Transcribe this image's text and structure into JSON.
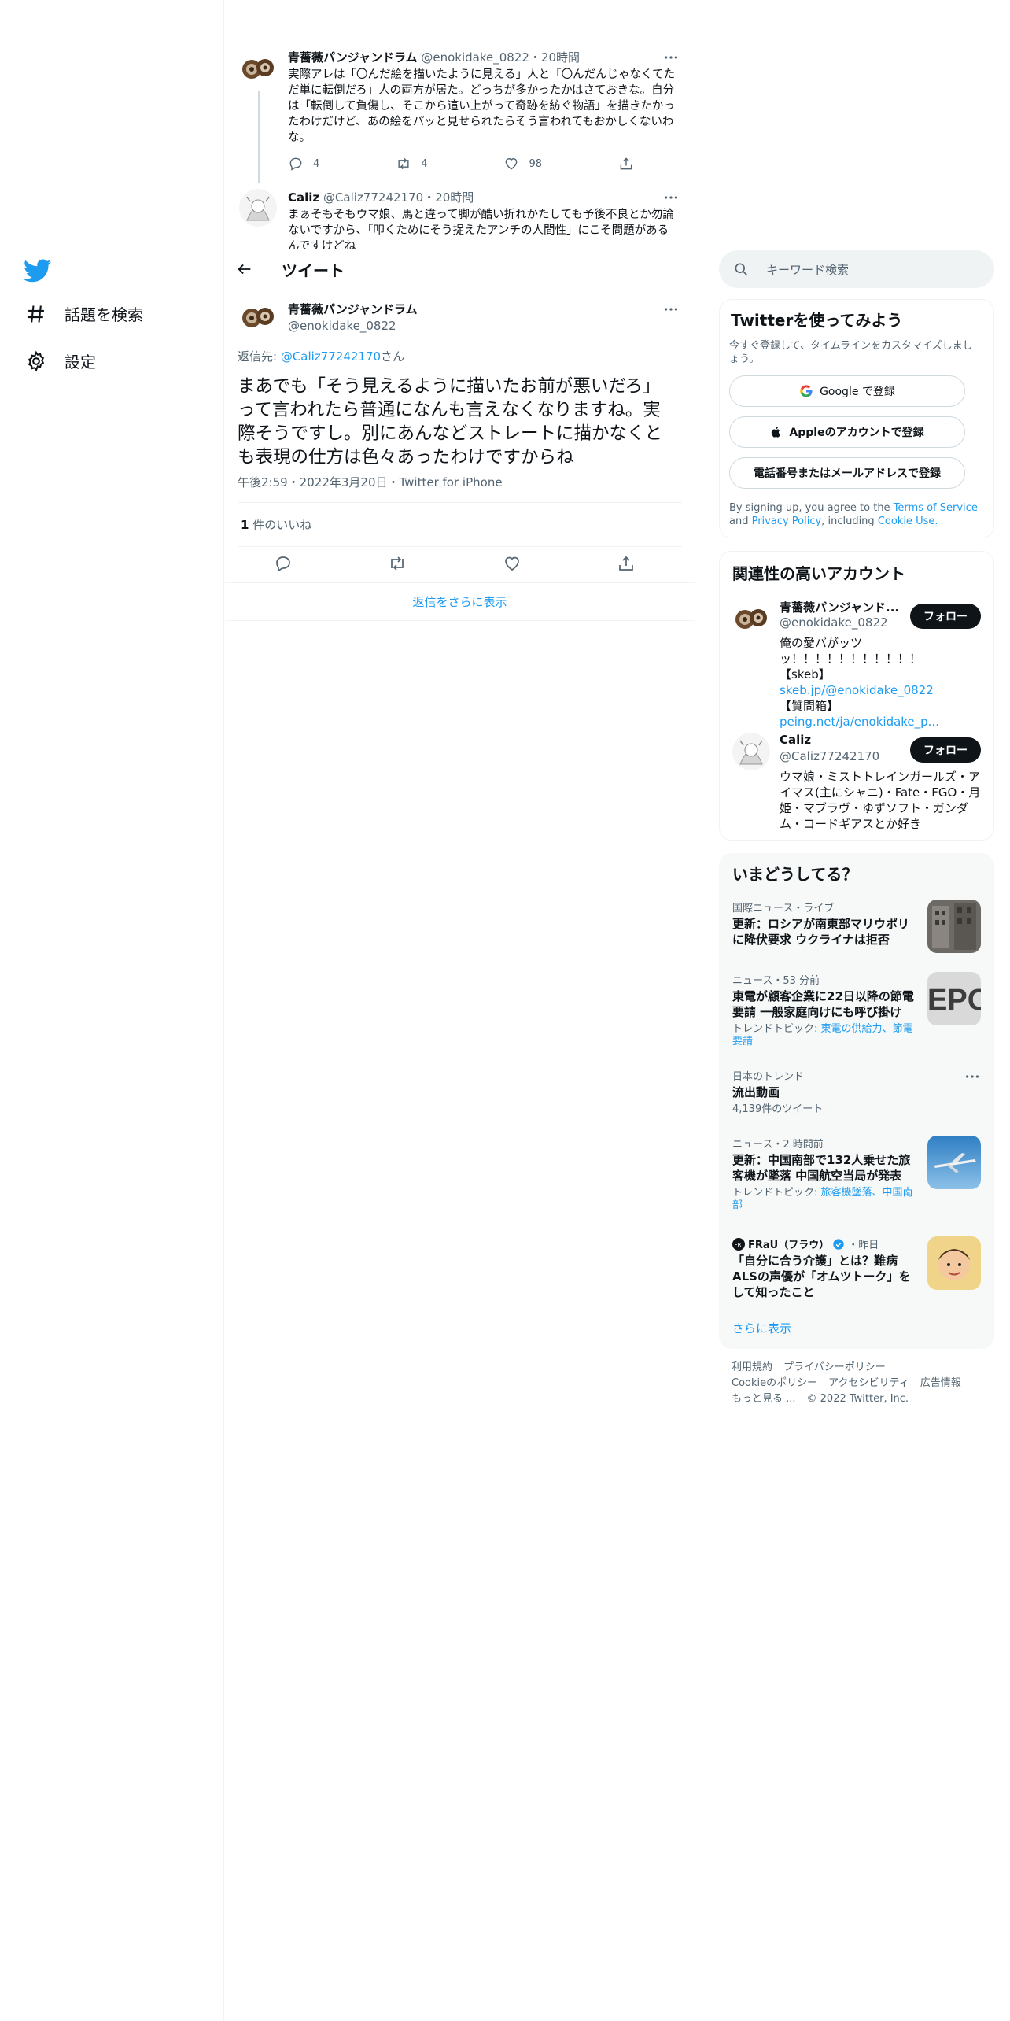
{
  "nav": {
    "items": [
      {
        "label": "話題を検索",
        "icon": "hashtag-icon"
      },
      {
        "label": "設定",
        "icon": "gear-icon"
      }
    ]
  },
  "header": {
    "title": "ツイート"
  },
  "thread": [
    {
      "name": "青薔薇パンジャンドラム",
      "handle": "@enokidake_0822",
      "time": "20時間",
      "text": "実際アレは「〇んだ絵を描いたように見える」人と「〇んだんじゃなくてただ単に転倒だろ」人の両方が居た。どっちが多かったかはさておきな。自分は「転倒して負傷し、そこから這い上がって奇跡を紡ぐ物語」を描きたかったわけだけど、あの絵をパッと見せられたらそう言われてもおかしくないわな。",
      "replies": "4",
      "retweets": "4",
      "likes": "98"
    },
    {
      "name": "Caliz",
      "handle": "@Caliz77242170",
      "time": "20時間",
      "text": "まぁそもそもウマ娘、馬と違って脚が酷い折れかたしても予後不良とか勿論ないですから、「叩くためにそう捉えたアンチの人間性」にこそ問題があるんですけどね"
    }
  ],
  "focus": {
    "name": "青薔薇パンジャンドラム",
    "handle": "@enokidake_0822",
    "reply_prefix": "返信先: ",
    "reply_to": "@Caliz77242170",
    "reply_suffix": "さん",
    "text": "まあでも「そう見えるように描いたお前が悪いだろ」って言われたら普通になんも言えなくなりますね。実際そうですし。別にあんなどストレートに描かなくとも表現の仕方は色々あったわけですからね",
    "timestamp": "午後2:59・2022年3月20日・Twitter for iPhone",
    "like_count": "1",
    "like_label": " 件のいいね",
    "show_more": "返信をさらに表示"
  },
  "search": {
    "placeholder": "キーワード検索"
  },
  "signup": {
    "title": "Twitterを使ってみよう",
    "subtitle": "今すぐ登録して、タイムラインをカスタマイズしましょう。",
    "google": "Google で登録",
    "apple": "Appleのアカウントで登録",
    "phone": "電話番号またはメールアドレスで登録",
    "terms_prefix": "By signing up, you agree to the ",
    "terms": "Terms of Service",
    "and": " and ",
    "privacy": "Privacy Policy",
    "including": ", including ",
    "cookie": "Cookie Use."
  },
  "related": {
    "title": "関連性の高いアカウント",
    "follow": "フォロー",
    "accounts": [
      {
        "name": "青薔薇パンジャンド...",
        "handle": "@enokidake_0822",
        "bio1": "俺の愛バがッツッ！！！！！！！！！！！",
        "bio2_prefix": "【skeb】",
        "bio2_link": "skeb.jp/@enokidake_0822",
        "bio3_prefix": "【質問箱】",
        "bio3_link": "peing.net/ja/enokidake_p..."
      },
      {
        "name": "Caliz",
        "handle": "@Caliz77242170",
        "bio": "ウマ娘・ミストトレインガールズ・アイマス(主にシャニ)・Fate・FGO・月姫・マブラヴ・ゆずソフト・ガンダム・コードギアスとか好き"
      }
    ]
  },
  "trends": {
    "title": "いまどうしてる？",
    "items": [
      {
        "meta": "国際ニュース・ライブ",
        "title": "更新：ロシアが南東部マリウポリに降伏要求 ウクライナは拒否"
      },
      {
        "meta": "ニュース・53 分前",
        "title": "東電が顧客企業に22日以降の節電要請 一般家庭向けにも呼び掛け",
        "sub_prefix": "トレンドトピック: ",
        "sub_links": "東電の供給力、節電要請"
      },
      {
        "meta": "日本のトレンド",
        "title": "流出動画",
        "count": "4,139件のツイート"
      },
      {
        "meta": "ニュース・2 時間前",
        "title": "更新：中国南部で132人乗せた旅客機が墜落 中国航空当局が発表",
        "sub_prefix": "トレンドトピック: ",
        "sub_links": "旅客機墜落、中国南部"
      },
      {
        "author": "FRaU（フラウ）",
        "when": "・昨日",
        "title": "「自分に合う介護」とは？難病ALSの声優が「オムツトーク」をして知ったこと"
      }
    ],
    "show_more": "さらに表示"
  },
  "footer": {
    "links": [
      "利用規約",
      "プライバシーポリシー",
      "Cookieのポリシー",
      "アクセシビリティ",
      "広告情報",
      "もっと見る ..."
    ],
    "copyright": "© 2022 Twitter, Inc."
  },
  "colors": {
    "accent": "#1d9bf0",
    "text": "#0f1419",
    "muted": "#536471",
    "border": "#eff3f4"
  }
}
